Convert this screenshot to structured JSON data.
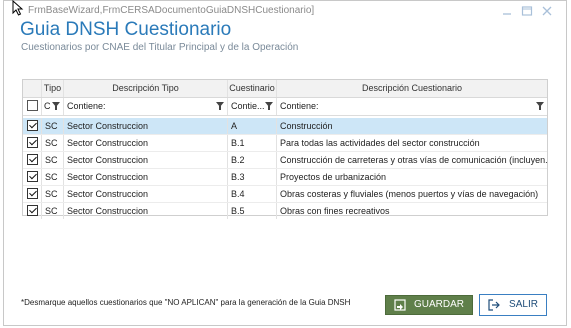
{
  "window": {
    "caption": "FrmBaseWizard,FrmCERSADocumentoGuiaDNSHCuestionario]",
    "title": "Guia DNSH Cuestionario",
    "subtitle": "Cuestionarios por CNAE del Titular Principal y de la Operación"
  },
  "grid": {
    "headers": {
      "tipo": "Tipo",
      "descripcion_tipo": "Descripción Tipo",
      "cuestionario": "Cuestinario",
      "descripcion_cuestionario": "Descripción Cuestionario"
    },
    "filter": {
      "tipo": "C",
      "descripcion_tipo": "Contiene:",
      "cuestionario": "Contie...",
      "descripcion_cuestionario": "Contiene:"
    },
    "rows": [
      {
        "checked": true,
        "tipo": "SC",
        "descripcion_tipo": "Sector Construccion",
        "cuestionario": "A",
        "descripcion_cuestionario": "Construcción",
        "selected": true
      },
      {
        "checked": true,
        "tipo": "SC",
        "descripcion_tipo": "Sector Construccion",
        "cuestionario": "B.1",
        "descripcion_cuestionario": "Para todas las actividades del sector construcción",
        "selected": false
      },
      {
        "checked": true,
        "tipo": "SC",
        "descripcion_tipo": "Sector Construccion",
        "cuestionario": "B.2",
        "descripcion_cuestionario": "Construcción de carreteras y otras vías de comunicación (incluyen...",
        "selected": false
      },
      {
        "checked": true,
        "tipo": "SC",
        "descripcion_tipo": "Sector Construccion",
        "cuestionario": "B.3",
        "descripcion_cuestionario": "Proyectos de urbanización",
        "selected": false
      },
      {
        "checked": true,
        "tipo": "SC",
        "descripcion_tipo": "Sector Construccion",
        "cuestionario": "B.4",
        "descripcion_cuestionario": "Obras costeras y fluviales (menos puertos y vías de navegación)",
        "selected": false
      },
      {
        "checked": true,
        "tipo": "SC",
        "descripcion_tipo": "Sector Construccion",
        "cuestionario": "B.5",
        "descripcion_cuestionario": "Obras con fines recreativos",
        "selected": false
      }
    ]
  },
  "footer": {
    "note": "*Desmarque aquellos cuestionarios que \"NO APLICAN\" para la generación de la Guia DNSH",
    "save_label": "GUARDAR",
    "exit_label": "SALIR"
  },
  "colors": {
    "title": "#2a7ab9",
    "selected_row": "#cde6f7",
    "save_button": "#5f7f4a",
    "exit_border": "#3a7fc2"
  },
  "icons": {
    "save": "save-icon",
    "exit": "exit-icon",
    "filter": "funnel-icon"
  }
}
